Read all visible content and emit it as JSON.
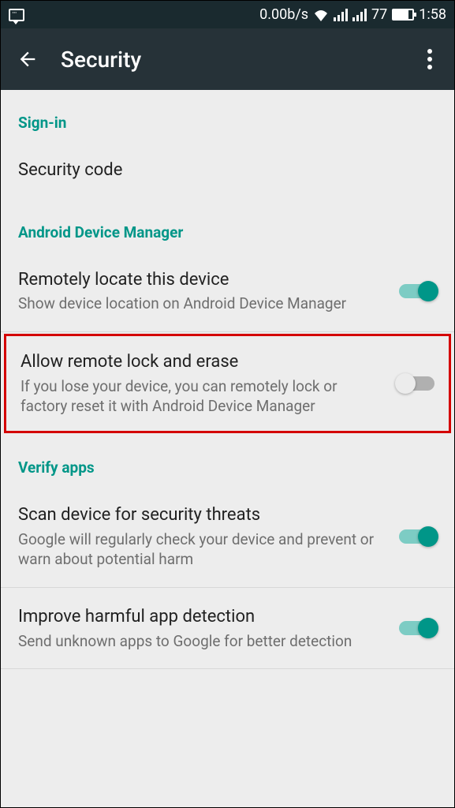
{
  "status": {
    "data_rate": "0.00b/s",
    "battery_level": "77",
    "time": "1:58"
  },
  "header": {
    "title": "Security"
  },
  "sections": {
    "signin": {
      "label": "Sign-in",
      "items": {
        "security_code": {
          "title": "Security code"
        }
      }
    },
    "adm": {
      "label": "Android Device Manager",
      "items": {
        "locate": {
          "title": "Remotely locate this device",
          "subtitle": "Show device location on Android Device Manager"
        },
        "erase": {
          "title": "Allow remote lock and erase",
          "subtitle": "If you lose your device, you can remotely lock or factory reset it with Android Device Manager"
        }
      }
    },
    "verify": {
      "label": "Verify apps",
      "items": {
        "scan": {
          "title": "Scan device for security threats",
          "subtitle": "Google will regularly check your device and prevent or warn about potential harm"
        },
        "improve": {
          "title": "Improve harmful app detection",
          "subtitle": "Send unknown apps to Google for better detection"
        }
      }
    }
  }
}
